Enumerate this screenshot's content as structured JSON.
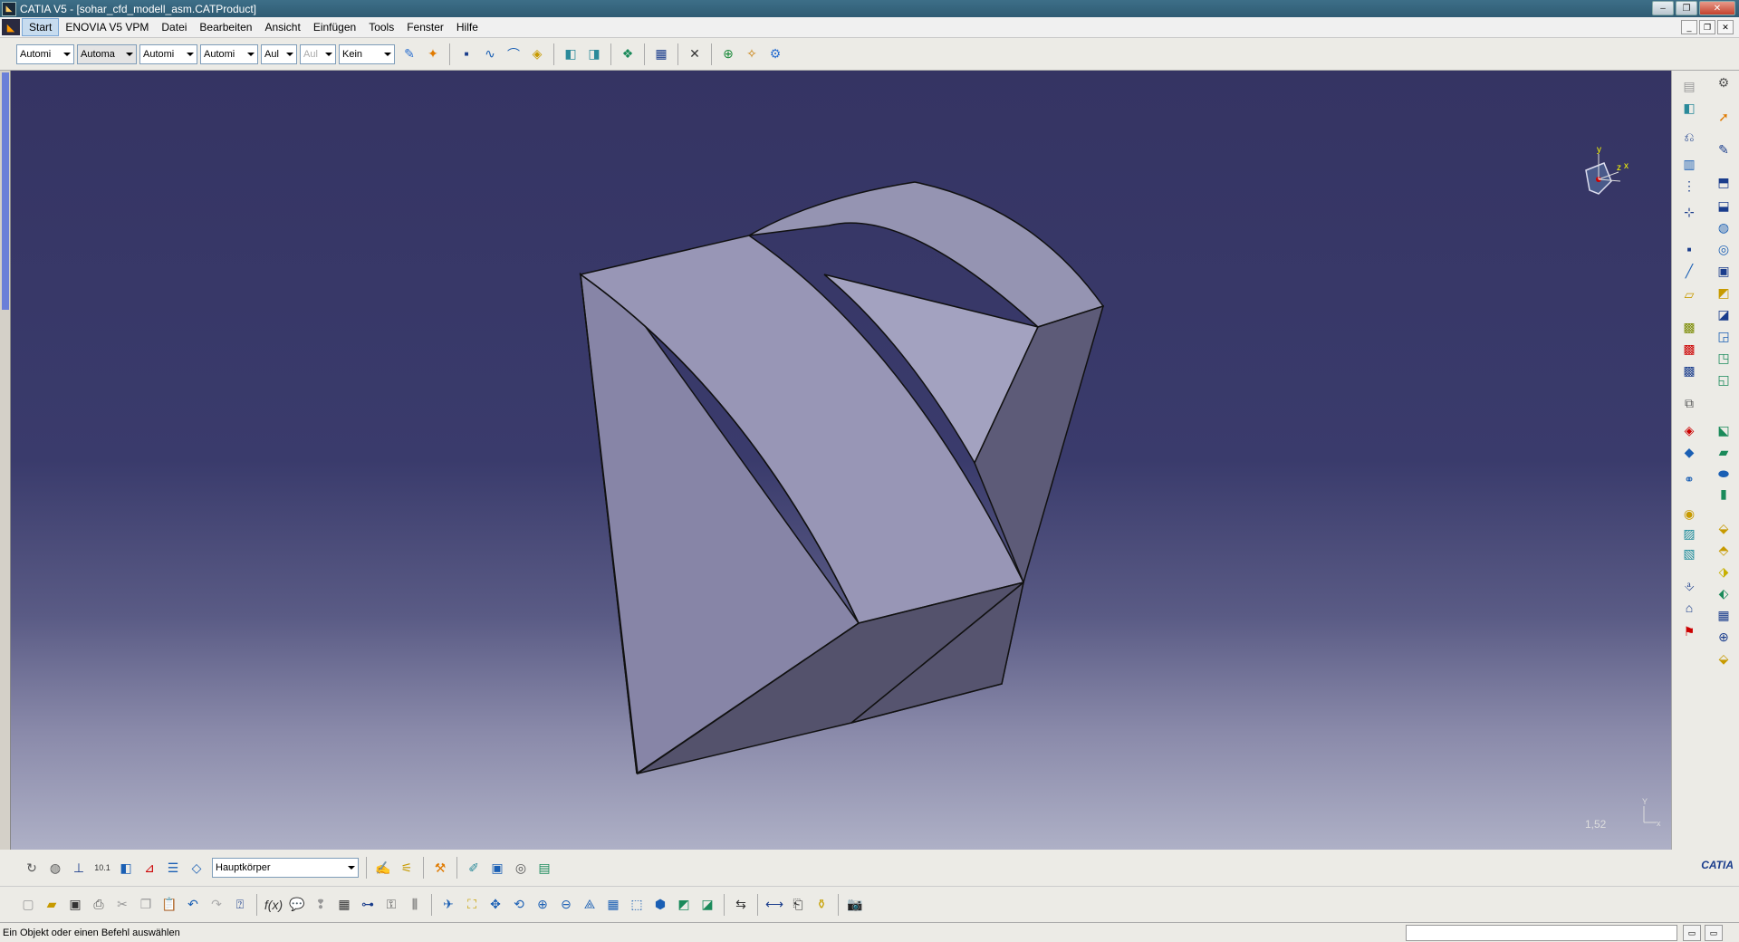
{
  "window": {
    "title": "CATIA V5 - [sohar_cfd_modell_asm.CATProduct]",
    "minimize": "–",
    "maximize": "❐",
    "close": "✕"
  },
  "menu": {
    "items": [
      "Start",
      "ENOVIA V5 VPM",
      "Datei",
      "Bearbeiten",
      "Ansicht",
      "Einfügen",
      "Tools",
      "Fenster",
      "Hilfe"
    ],
    "active_index": 0
  },
  "toolbar_top": {
    "combos": [
      "Automi",
      "Automa",
      "Automi",
      "Automi",
      "Aul",
      "Aul",
      "Kein"
    ]
  },
  "viewport": {
    "zoom": "1,52",
    "compass_axes": [
      "y",
      "z",
      "x"
    ],
    "mini_axes": [
      "Y",
      "x"
    ],
    "background_top": "#353463",
    "background_bottom": "#aeb0c6",
    "face_colors": {
      "top_left": "#9a98b4",
      "top_mid": "#9a9ab8",
      "left": "#8482a6",
      "right": "#5a5874",
      "bottom": "#52506a"
    }
  },
  "bottom_toolbar": {
    "body_select": "Hauptkörper"
  },
  "status": {
    "message": "Ein Objekt oder einen Befehl auswählen"
  },
  "brand": {
    "logo_text": "CATIA"
  }
}
